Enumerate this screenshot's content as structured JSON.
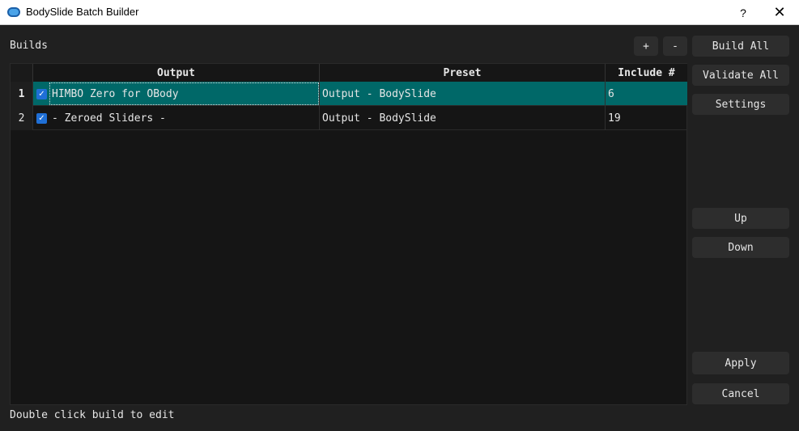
{
  "window": {
    "title": "BodySlide Batch Builder",
    "help_label": "?",
    "close_label": "✕"
  },
  "builds_label": "Builds",
  "toolbar": {
    "add_label": "+",
    "remove_label": "-"
  },
  "sidebar": {
    "build_all": "Build All",
    "validate_all": "Validate All",
    "settings": "Settings",
    "up": "Up",
    "down": "Down",
    "apply": "Apply",
    "cancel": "Cancel"
  },
  "table": {
    "columns": [
      "Output",
      "Preset",
      "Include #"
    ],
    "rows": [
      {
        "num": "1",
        "checked": true,
        "output": "HIMBO Zero for OBody",
        "preset": "Output - BodySlide",
        "include": "6",
        "selected": true
      },
      {
        "num": "2",
        "checked": true,
        "output": "- Zeroed Sliders -",
        "preset": "Output - BodySlide",
        "include": "19",
        "selected": false
      }
    ]
  },
  "status_text": "Double click build to edit",
  "colors": {
    "selection": "#006868",
    "checkbox": "#1f6fd6",
    "background": "#202020"
  }
}
